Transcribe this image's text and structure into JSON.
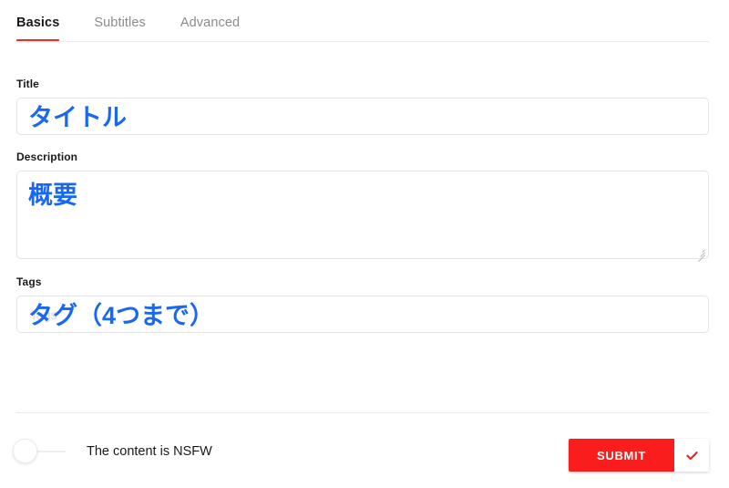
{
  "tabs": [
    {
      "label": "Basics",
      "active": true
    },
    {
      "label": "Subtitles",
      "active": false
    },
    {
      "label": "Advanced",
      "active": false
    }
  ],
  "form": {
    "title": {
      "label": "Title",
      "value": "タイトル",
      "placeholder": ""
    },
    "description": {
      "label": "Description",
      "value": "概要",
      "placeholder": ""
    },
    "tags": {
      "label": "Tags",
      "value": "タグ（4つまで）",
      "placeholder": "Tags"
    }
  },
  "footer": {
    "nsfw_toggle": {
      "label": "The content is NSFW",
      "state": "off"
    },
    "submit_label": "SUBMIT",
    "confirm_icon": "check-icon"
  },
  "colors": {
    "accent_red": "#f91d1d",
    "tab_underline": "#f02c2c",
    "value_blue": "#1869f0",
    "border": "#e4e4e4",
    "divider": "#ececec",
    "placeholder": "#d8d8d8"
  }
}
